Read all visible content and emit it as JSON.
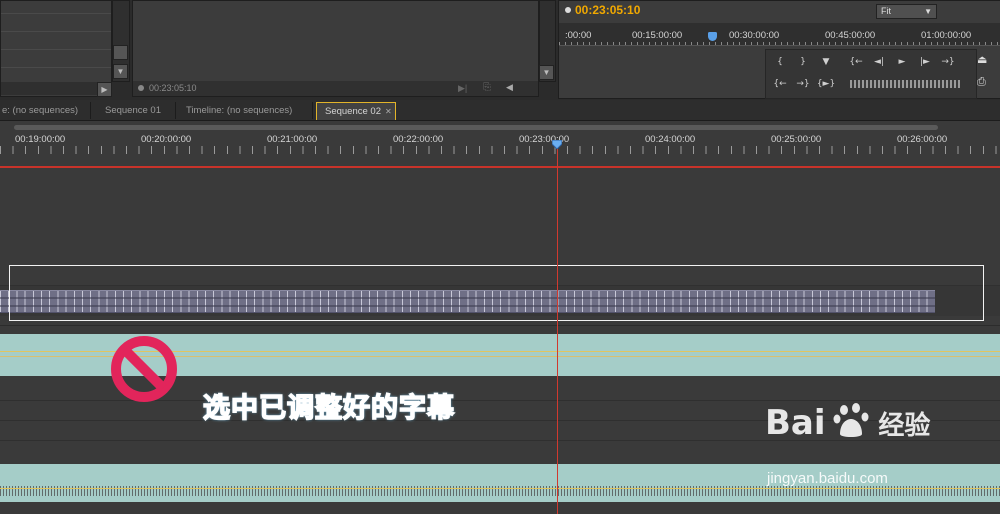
{
  "project_panel": {
    "timecode": "00:23:05:10"
  },
  "program_monitor": {
    "timecode": "00:23:05:10",
    "zoom": "Fit",
    "ruler_labels": [
      ":00:00",
      "00:15:00:00",
      "00:30:00:00",
      "00:45:00:00",
      "01:00:00:00"
    ],
    "controls_row1": [
      "{",
      "}",
      "▼",
      "{←",
      "◄|",
      "►",
      "|►",
      "→}"
    ],
    "controls_row2": [
      "{←",
      "→}",
      "{►}"
    ]
  },
  "tabs": [
    {
      "label": "e: (no sequences)",
      "active": false
    },
    {
      "label": "Sequence 01",
      "active": false
    },
    {
      "label": "Timeline: (no sequences)",
      "active": false
    },
    {
      "label": "Sequence 02",
      "active": true
    }
  ],
  "timeline": {
    "ruler_labels": [
      "00:19:00:00",
      "00:20:00:00",
      "00:21:00:00",
      "00:22:00:00",
      "00:23:00:00",
      "00:24:00:00",
      "00:25:00:00",
      "00:26:00:00"
    ]
  },
  "annotation": {
    "caption": "选中已调整好的字幕",
    "icon": "prohibited-icon"
  },
  "watermark": {
    "brand": "Bai",
    "brand_suffix": "经验",
    "url": "jingyan.baidu.com"
  },
  "colors": {
    "timecode": "#f0a800",
    "playhead": "#d0392f",
    "subtitle_clip": "#6f6f86",
    "audio_clip": "#a5cdc8",
    "caption": "#2f9bff"
  }
}
